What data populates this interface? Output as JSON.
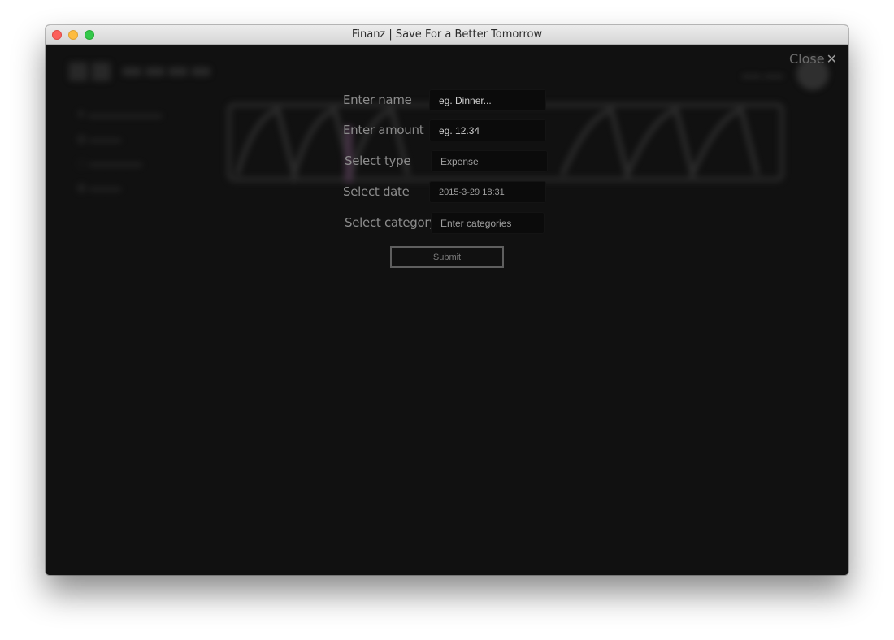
{
  "window": {
    "title": "Finanz | Save For a Better Tomorrow"
  },
  "overlay": {
    "close_label": "Close",
    "close_icon": "close-icon"
  },
  "form": {
    "fields": [
      {
        "label": "Enter name",
        "placeholder": "eg. Dinner..."
      },
      {
        "label": "Enter amount",
        "placeholder": "eg. 12.34"
      },
      {
        "label": "Select type",
        "placeholder": "Expense"
      },
      {
        "label": "Select date",
        "placeholder": "2015-3-29 18:31"
      },
      {
        "label": "Select category",
        "placeholder": "Enter categories"
      }
    ],
    "submit_label": "Submit"
  },
  "colors": {
    "overlay_bg": "#111111",
    "traffic_close": "#fc605c",
    "traffic_minimize": "#fdbc40",
    "traffic_maximize": "#34c84a"
  }
}
